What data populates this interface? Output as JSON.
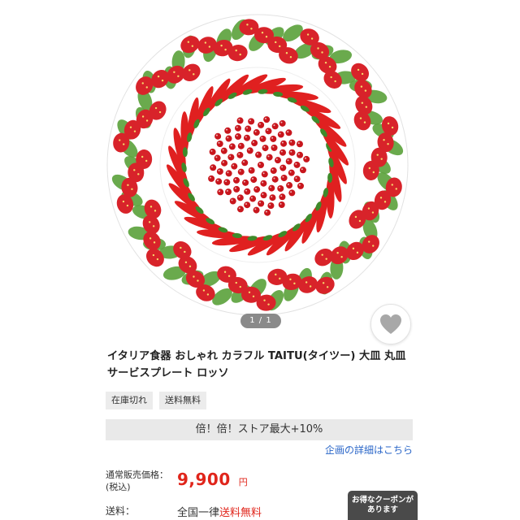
{
  "gallery": {
    "image_alt": "Taitu round plate with strawberries and red chili peppers",
    "pager_text": "1 / 1",
    "favorite_icon": "heart-icon"
  },
  "product": {
    "title": "イタリア食器 おしゃれ カラフル TAITU(タイツー) 大皿 丸皿 サービスプレート ロッソ",
    "tags": [
      "在庫切れ",
      "送料無料"
    ]
  },
  "promo": {
    "banner": "倍！倍！ストア最大+10%",
    "detail_link": "企画の詳細はこちら"
  },
  "price": {
    "label_line1": "通常販売価格：",
    "label_line2": "(税込)",
    "amount": "9,900",
    "unit": "円"
  },
  "shipping": {
    "label": "送料：",
    "value_prefix": "全国一律",
    "value_free": "送料無料"
  },
  "coupon": {
    "line1": "お得なクーポンが",
    "line2": "あります"
  },
  "colors": {
    "price_red": "#e0251b",
    "link_blue": "#2a66c8",
    "coupon_bg": "#4a4a4a"
  }
}
